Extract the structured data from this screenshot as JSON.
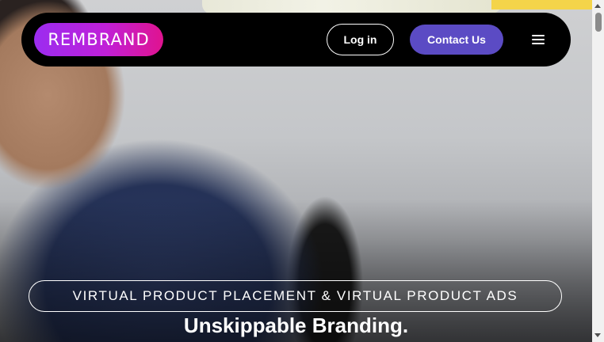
{
  "navbar": {
    "logo_text": "REMBRAND",
    "login_label": "Log in",
    "contact_label": "Contact Us",
    "menu_icon": "hamburger-menu-icon"
  },
  "hero": {
    "tagline": "VIRTUAL PRODUCT PLACEMENT & VIRTUAL PRODUCT ADS",
    "headline": "Unskippable Branding."
  },
  "colors": {
    "navbar_bg": "#000000",
    "logo_gradient_start": "#9b2cf0",
    "logo_gradient_end": "#e0138f",
    "contact_button": "#5b4bc4",
    "text": "#ffffff"
  }
}
